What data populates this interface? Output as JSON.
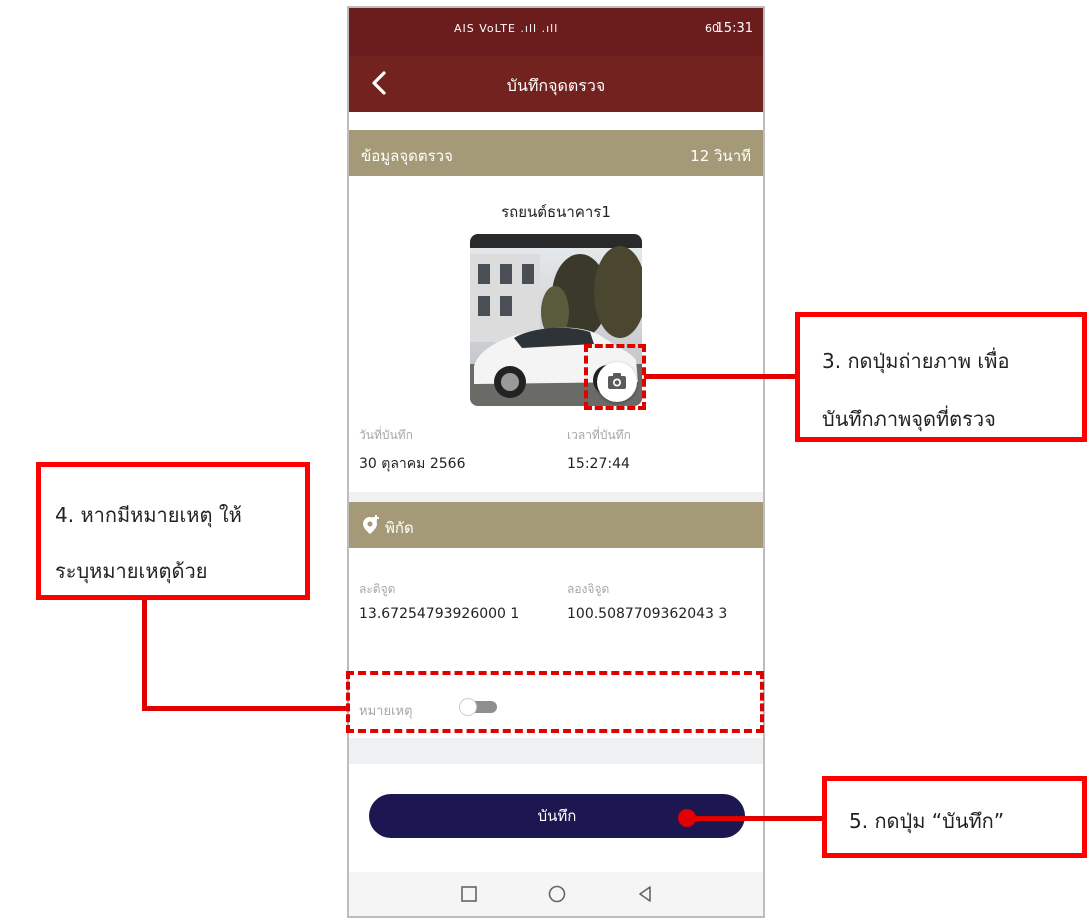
{
  "status_bar": {
    "signal_text": "AIS VoLTE .ıll .ıll",
    "battery": "60",
    "time": "15:31"
  },
  "app_bar": {
    "title": "บันทึกจุดตรวจ",
    "back_icon": "chevron-left-icon"
  },
  "info_section": {
    "header_label": "ข้อมูลจุดตรวจ",
    "elapsed": "12 วินาที",
    "place_name": "รถยนต์ธนาคาร1",
    "date_label": "วันที่บันทึก",
    "date_value": "30 ตุลาคม 2566",
    "time_label": "เวลาที่บันทึก",
    "time_value": "15:27:44"
  },
  "coordinates_section": {
    "header_label": "พิกัด",
    "lat_label": "ละติจูด",
    "lat_value": "13.67254793926000 1",
    "lng_label": "ลองจิจูด",
    "lng_value": "100.5087709362043 3"
  },
  "note": {
    "label": "หมายเหตุ",
    "toggle_on": false
  },
  "save_button": {
    "label": "บันทึก"
  },
  "annotations": {
    "callout_camera": [
      "3. กดปุ่มถ่ายภาพ เพื่อ",
      "บันทึกภาพจุดที่ตรวจ"
    ],
    "callout_note": [
      "4. หากมีหมายเหตุ ให้",
      "ระบุหมายเหตุด้วย"
    ],
    "callout_save": "5. กดปุ่ม “บันทึก”"
  },
  "colors": {
    "app_bar": "#72231f",
    "section_bar": "#a49a78",
    "save_button": "#1c1651",
    "annotation": "#ff0000"
  }
}
